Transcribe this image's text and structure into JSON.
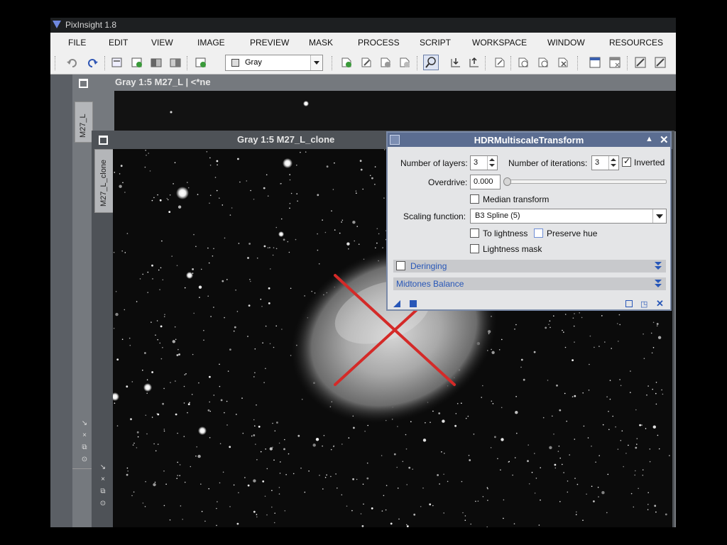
{
  "app": {
    "title": "PixInsight 1.8"
  },
  "menu": [
    "FILE",
    "EDIT",
    "VIEW",
    "IMAGE",
    "PREVIEW",
    "MASK",
    "PROCESS",
    "SCRIPT",
    "WORKSPACE",
    "WINDOW",
    "RESOURCES"
  ],
  "toolbar": {
    "colorspace_value": "Gray",
    "icons": [
      "undo-icon",
      "redo-icon",
      "new-image-icon",
      "clone-image-icon",
      "mask-icon",
      "preview-icon",
      "new-process-icon",
      "gray-combo",
      "new-preview-icon",
      "edit-preview-icon",
      "preview-list-icon",
      "delete-preview-icon",
      "readout-icon",
      "zoom-in-icon",
      "zoom-out-icon",
      "fit-icon",
      "pan-icon",
      "mask-visible-icon",
      "mask-invert-icon",
      "workspace-icon",
      "tile-icon",
      "process-icon-a",
      "process-icon-b"
    ]
  },
  "windows": {
    "back": {
      "title": "Gray 1:5 M27_L | <*ne",
      "tab_label": "M27_L"
    },
    "front": {
      "title": "Gray 1:5 M27_L_clone",
      "tab_label": "M27_L_clone"
    }
  },
  "panel": {
    "title": "HDRMultiscaleTransform",
    "num_layers_label": "Number of layers:",
    "num_layers_value": "3",
    "num_iterations_label": "Number of iterations:",
    "num_iterations_value": "3",
    "inverted_label": "Inverted",
    "inverted_checked": true,
    "overdrive_label": "Overdrive:",
    "overdrive_value": "0.000",
    "median_transform_label": "Median transform",
    "median_transform_checked": false,
    "scaling_function_label": "Scaling function:",
    "scaling_function_value": "B3 Spline (5)",
    "to_lightness_label": "To lightness",
    "to_lightness_checked": false,
    "preserve_hue_label": "Preserve hue",
    "preserve_hue_checked": false,
    "lightness_mask_label": "Lightness mask",
    "lightness_mask_checked": false,
    "deringing_label": "Deringing",
    "deringing_checked": false,
    "midtones_label": "Midtones Balance"
  },
  "colors": {
    "panel_title_bg": "#5b6d91",
    "section_text": "#2857b8",
    "annotation_x": "#d42a28"
  }
}
